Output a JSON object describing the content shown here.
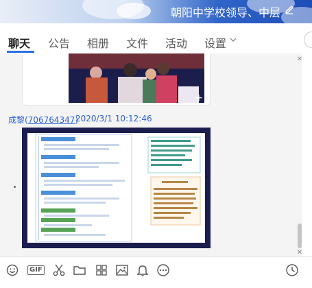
{
  "window": {
    "title": "朝阳中学校领导、中层"
  },
  "tabs": [
    {
      "label": "聊天",
      "active": true
    },
    {
      "label": "公告",
      "active": false
    },
    {
      "label": "相册",
      "active": false
    },
    {
      "label": "文件",
      "active": false
    },
    {
      "label": "活动",
      "active": false
    },
    {
      "label": "设置",
      "active": false
    }
  ],
  "message": {
    "sender_name": "成黎",
    "sender_qq": "706764347",
    "timestamp": "2020/3/1 10:12:46"
  },
  "colors": {
    "accent": "#2b6fe0",
    "sender_link": "#2b5fd1",
    "header_dark": "#1e4db8"
  },
  "icons": {
    "toolbar": [
      "emoji-icon",
      "gif-icon",
      "scissors-icon",
      "folder-icon",
      "apps-icon",
      "image-icon",
      "bell-icon",
      "more-icon",
      "history-icon"
    ]
  }
}
